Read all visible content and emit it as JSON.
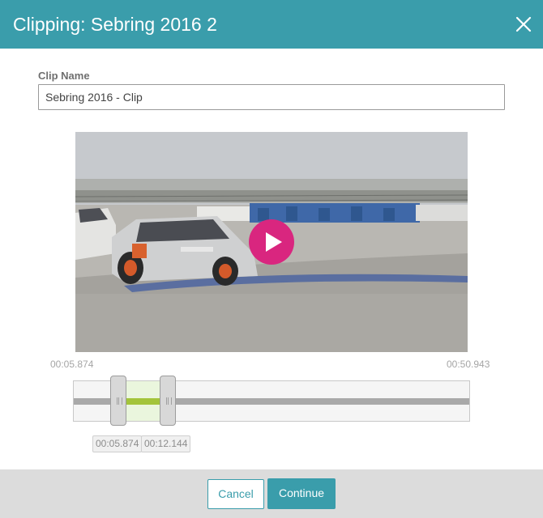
{
  "header": {
    "title": "Clipping: Sebring 2016 2",
    "close_icon": "close-icon"
  },
  "form": {
    "clip_name_label": "Clip Name",
    "clip_name_value": "Sebring 2016 - Clip"
  },
  "video": {
    "play_icon": "play-icon"
  },
  "timeline": {
    "start_time": "00:05.874",
    "end_time": "00:50.943",
    "clip_start": "00:05.874",
    "clip_end": "00:12.144"
  },
  "footer": {
    "cancel_label": "Cancel",
    "continue_label": "Continue"
  },
  "colors": {
    "accent": "#3a9dab",
    "play_button": "#d9267f",
    "selection": "#a3c43a"
  }
}
